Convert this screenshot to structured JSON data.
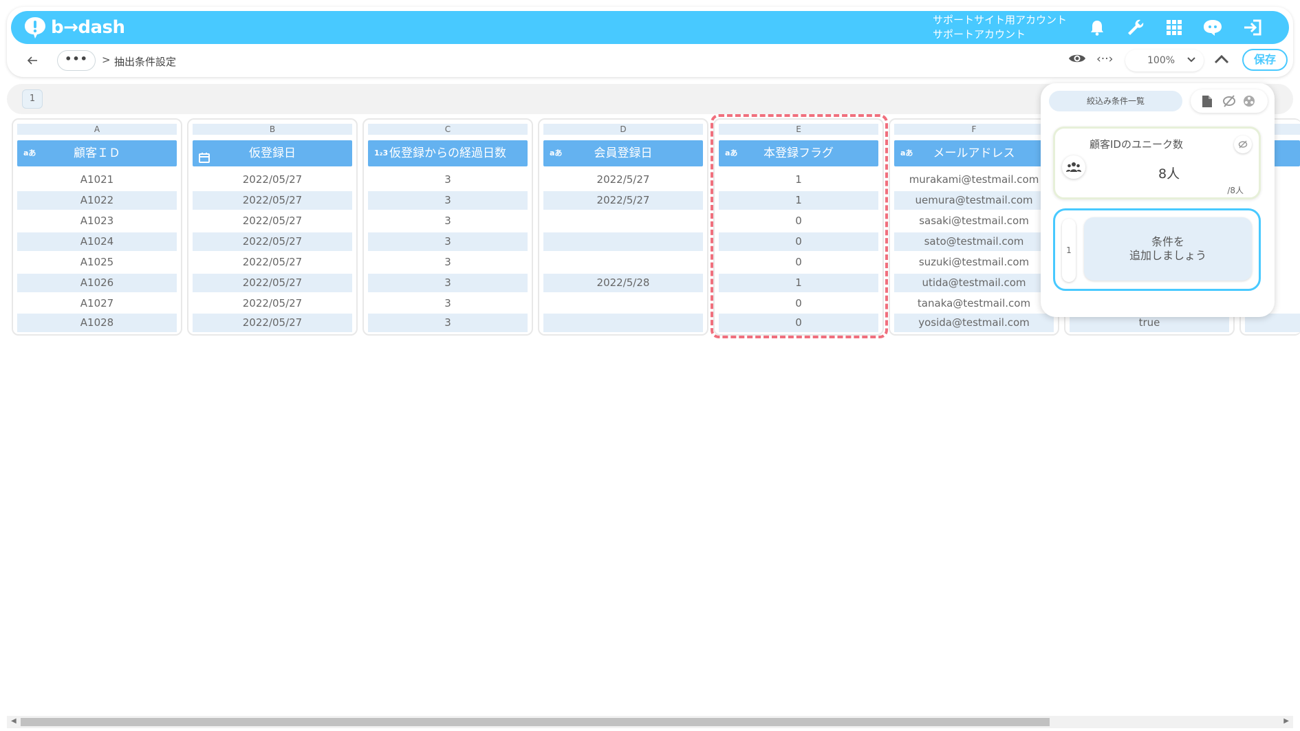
{
  "app": {
    "logo_text": "b→dash",
    "account_line1": "サポートサイト用アカウント",
    "account_line2": "サポートアカウント"
  },
  "breadcrumb": {
    "dots": "•••",
    "separator": ">",
    "title": "抽出条件設定"
  },
  "toolbar": {
    "zoom": "100%",
    "save_label": "保存"
  },
  "sheet_tab": "1",
  "columns": [
    {
      "letter": "A",
      "header": "顧客ＩＤ",
      "type_icon": "aあ",
      "cells": [
        "A1021",
        "A1022",
        "A1023",
        "A1024",
        "A1025",
        "A1026",
        "A1027",
        "A1028"
      ]
    },
    {
      "letter": "B",
      "header": "仮登録日",
      "type_icon": "calendar",
      "cells": [
        "2022/05/27",
        "2022/05/27",
        "2022/05/27",
        "2022/05/27",
        "2022/05/27",
        "2022/05/27",
        "2022/05/27",
        "2022/05/27"
      ]
    },
    {
      "letter": "C",
      "header": "仮登録からの経過日数",
      "type_icon": "1₂3",
      "cells": [
        "3",
        "3",
        "3",
        "3",
        "3",
        "3",
        "3",
        "3"
      ]
    },
    {
      "letter": "D",
      "header": "会員登録日",
      "type_icon": "aあ",
      "cells": [
        "2022/5/27",
        "2022/5/27",
        "",
        "",
        "",
        "2022/5/28",
        "",
        ""
      ]
    },
    {
      "letter": "E",
      "header": "本登録フラグ",
      "type_icon": "aあ",
      "cells": [
        "1",
        "1",
        "0",
        "0",
        "0",
        "1",
        "0",
        "0"
      ]
    },
    {
      "letter": "F",
      "header": "メールアドレス",
      "type_icon": "aあ",
      "cells": [
        "murakami@testmail.com",
        "uemura@testmail.com",
        "sasaki@testmail.com",
        "sato@testmail.com",
        "suzuki@testmail.com",
        "utida@testmail.com",
        "tanaka@testmail.com",
        "yosida@testmail.com"
      ]
    },
    {
      "letter": "",
      "header": "",
      "type_icon": "",
      "cells": [
        "",
        "",
        "",
        "",
        "",
        "",
        "",
        "true"
      ]
    }
  ],
  "panel": {
    "tab_label": "絞込み条件一覧",
    "unique_label": "顧客IDのユニーク数",
    "unique_value": "8人",
    "unique_total": "/8人",
    "add_index": "1",
    "add_line1": "条件を",
    "add_line2": "追加しましょう"
  },
  "colors": {
    "brand": "#48c9ff",
    "header_blue": "#64b2f0",
    "row_alt": "#e3eef8",
    "highlight": "#f06f7d"
  }
}
